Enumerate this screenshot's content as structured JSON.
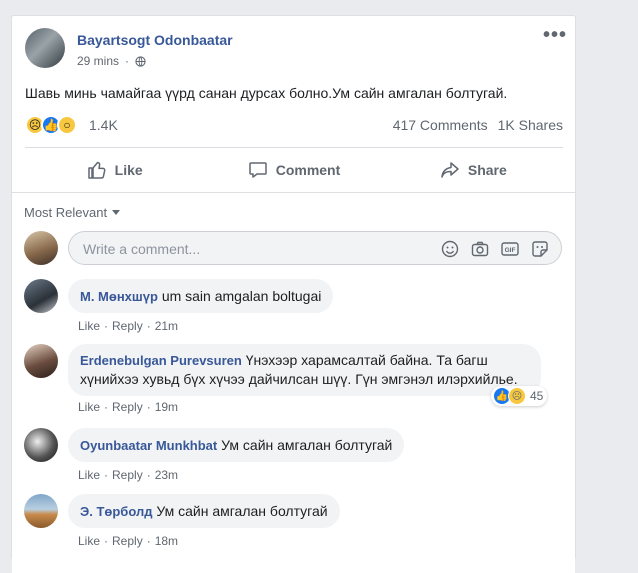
{
  "post": {
    "author": "Bayartsogt Odonbaatar",
    "time": "29 mins",
    "text": "Шавь минь чамайгаа үүрд санан дурсах болно.Ум сайн амгалан болтугай.",
    "reaction_count": "1.4K",
    "comments_count": "417 Comments",
    "shares_count": "1K Shares",
    "reaction_icons": [
      "sad-icon",
      "like-icon",
      "wow-icon"
    ]
  },
  "actions": {
    "like": "Like",
    "comment": "Comment",
    "share": "Share"
  },
  "sort": {
    "label": "Most Relevant"
  },
  "composer": {
    "placeholder": "Write a comment..."
  },
  "comments": [
    {
      "name": "М. Мөнхшүр",
      "text": "um sain amgalan boltugai",
      "like": "Like",
      "reply": "Reply",
      "time": "21m"
    },
    {
      "name": "Erdenebulgan Purevsuren",
      "text": "Үнэхээр харамсалтай байна. Та багш хүнийхээ хувьд бүх хүчээ дайчилсан шүү. Гүн эмгэнэл илэрхийлье.",
      "like": "Like",
      "reply": "Reply",
      "time": "19m",
      "reactions": "45"
    },
    {
      "name": "Oyunbaatar Munkhbat",
      "text": "Ум сайн амгалан болтугай",
      "like": "Like",
      "reply": "Reply",
      "time": "23m"
    },
    {
      "name": "Э. Төрболд",
      "text": "Ум сайн амгалан болтугай",
      "like": "Like",
      "reply": "Reply",
      "time": "18m"
    }
  ],
  "colors": {
    "link": "#385898",
    "muted": "#606770",
    "bubble": "#f2f3f5",
    "like_blue": "#1877f2",
    "emoji_yellow": "#f7c740"
  }
}
